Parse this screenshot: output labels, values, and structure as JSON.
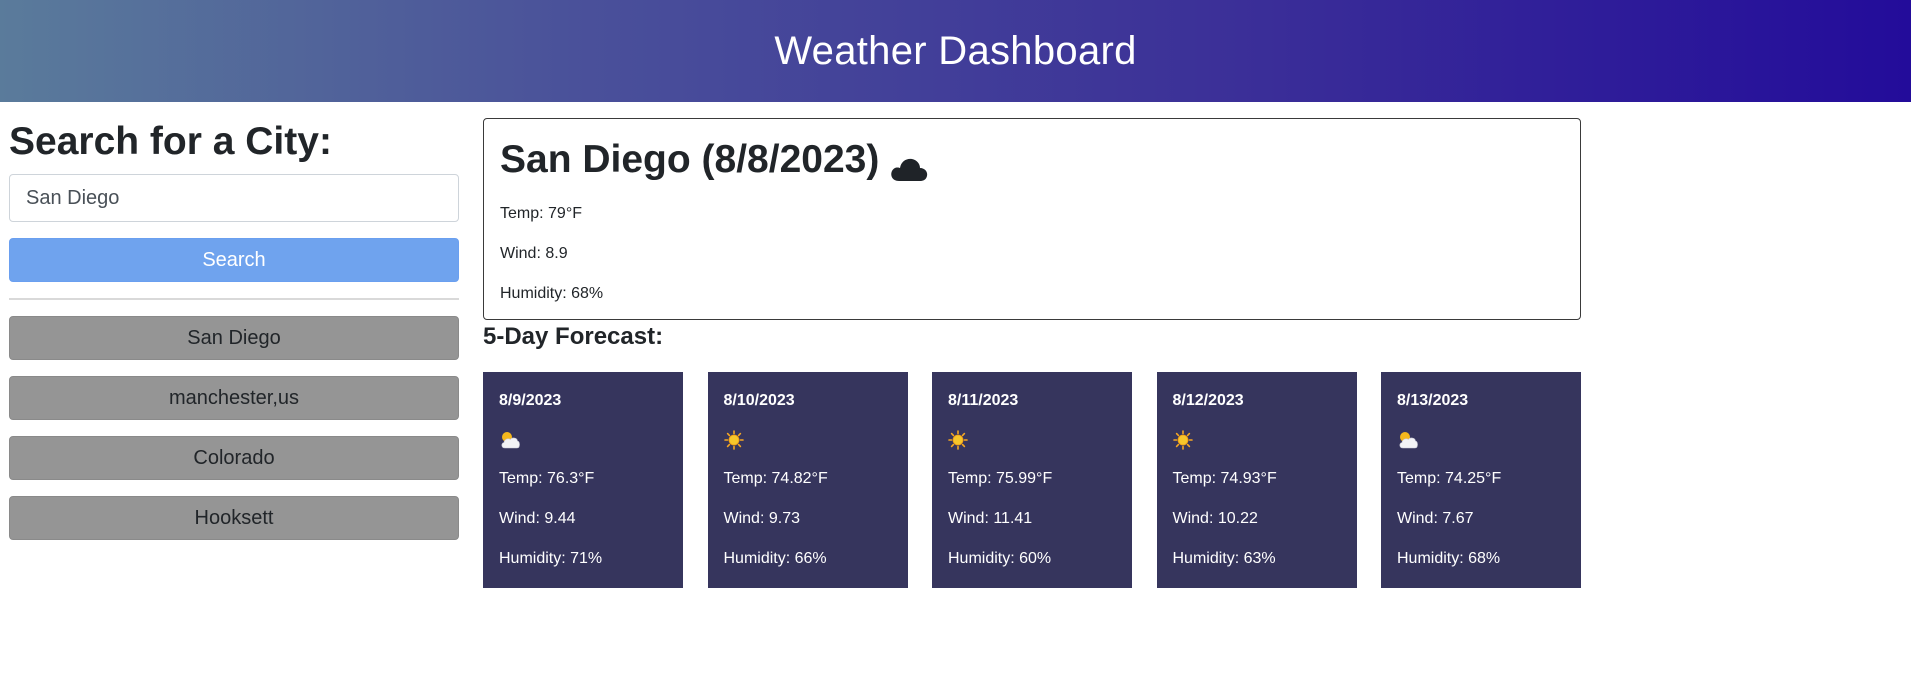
{
  "header": {
    "title": "Weather Dashboard"
  },
  "search": {
    "heading": "Search for a City:",
    "input_value": "San Diego",
    "placeholder": "",
    "button_label": "Search"
  },
  "history": [
    "San Diego",
    "manchester,us",
    "Colorado",
    "Hooksett"
  ],
  "current": {
    "title": "San Diego (8/8/2023)",
    "icon": "cloud-icon",
    "temp": "Temp: 79°F",
    "wind": "Wind: 8.9",
    "humidity": "Humidity: 68%"
  },
  "forecast": {
    "heading": "5-Day Forecast:",
    "days": [
      {
        "date": "8/9/2023",
        "icon": "partly-cloudy-icon",
        "temp": "Temp: 76.3°F",
        "wind": "Wind: 9.44",
        "humidity": "Humidity: 71%"
      },
      {
        "date": "8/10/2023",
        "icon": "sun-icon",
        "temp": "Temp: 74.82°F",
        "wind": "Wind: 9.73",
        "humidity": "Humidity: 66%"
      },
      {
        "date": "8/11/2023",
        "icon": "sun-icon",
        "temp": "Temp: 75.99°F",
        "wind": "Wind: 11.41",
        "humidity": "Humidity: 60%"
      },
      {
        "date": "8/12/2023",
        "icon": "sun-icon",
        "temp": "Temp: 74.93°F",
        "wind": "Wind: 10.22",
        "humidity": "Humidity: 63%"
      },
      {
        "date": "8/13/2023",
        "icon": "partly-cloudy-icon",
        "temp": "Temp: 74.25°F",
        "wind": "Wind: 7.67",
        "humidity": "Humidity: 68%"
      }
    ]
  },
  "colors": {
    "header_gradient_start": "#5a7b9b",
    "header_gradient_end": "#230c9a",
    "search_button": "#6fa3ee",
    "history_button": "#959595",
    "forecast_card": "#36355d"
  }
}
